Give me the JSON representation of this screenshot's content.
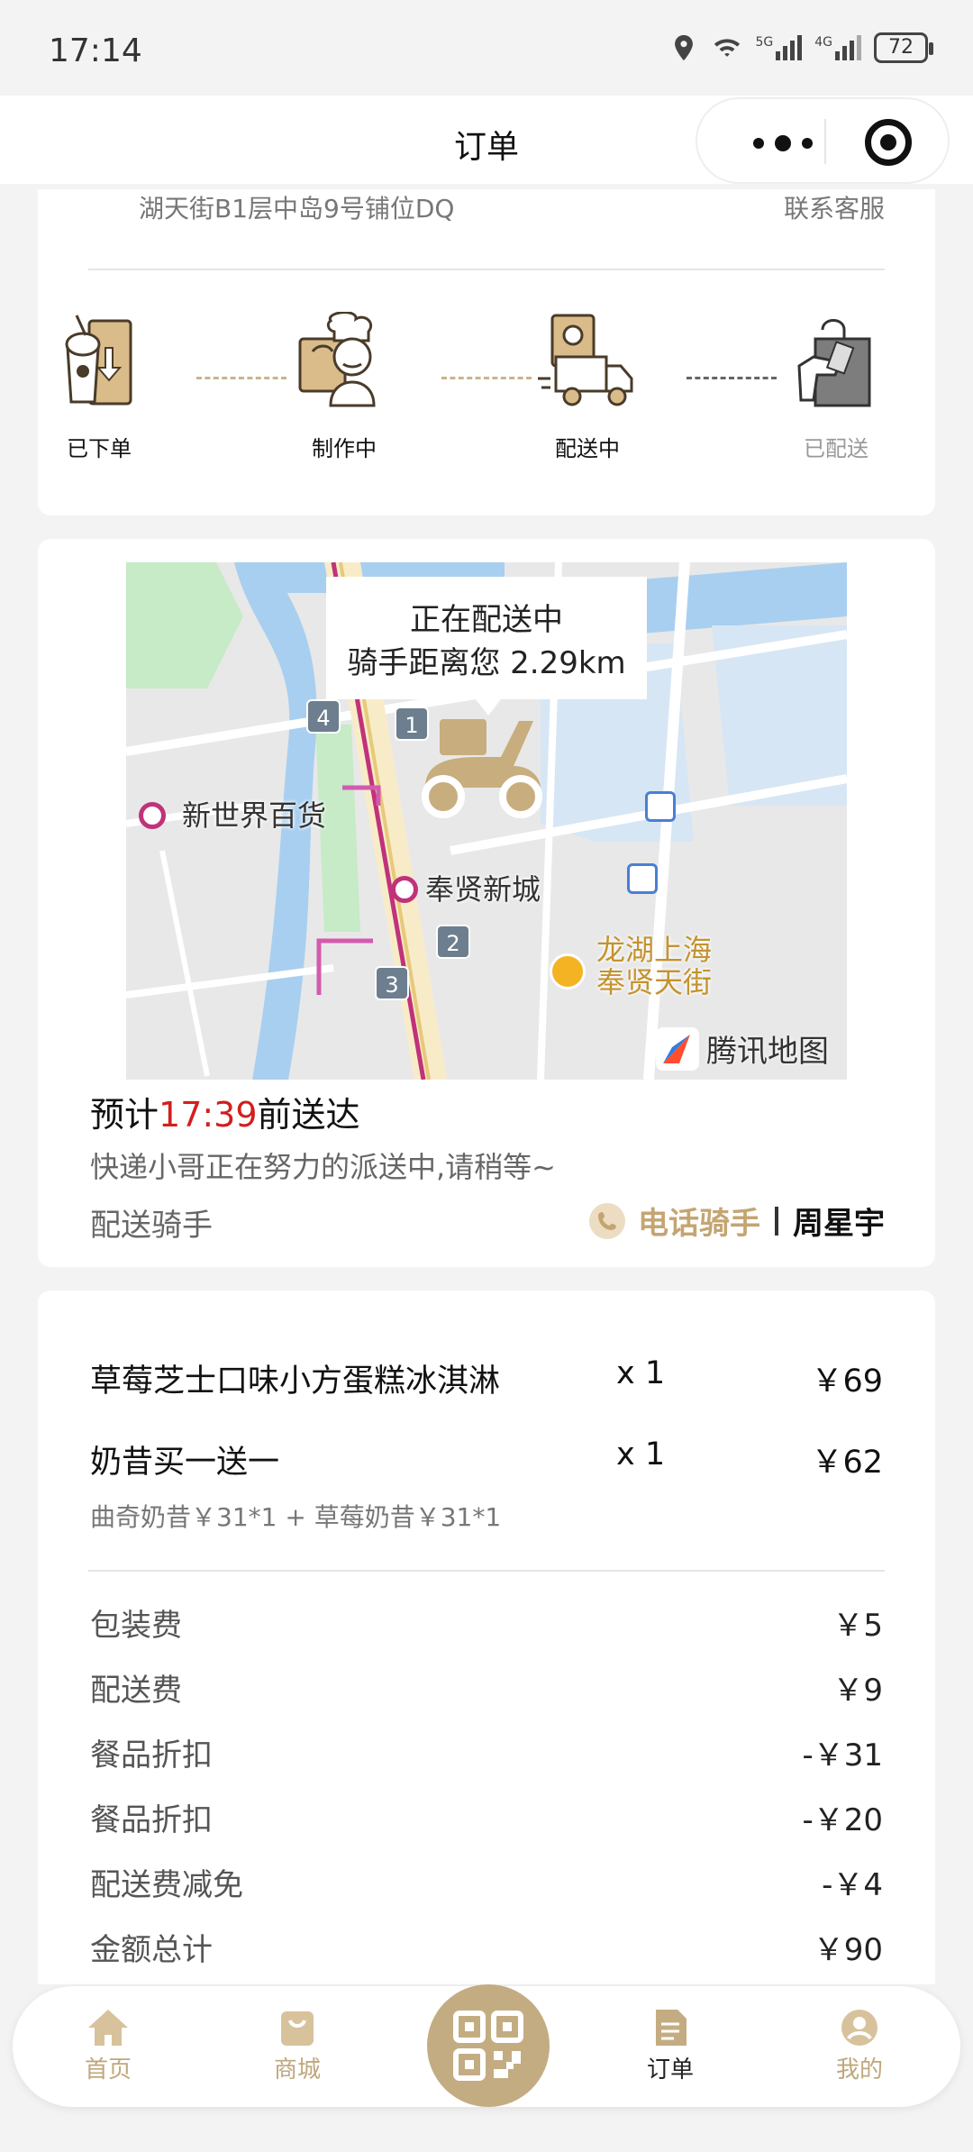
{
  "status_bar": {
    "time": "17:14",
    "battery": "72",
    "network_5g": "5G",
    "network_4g": "4G"
  },
  "nav": {
    "title": "订单"
  },
  "order_progress": {
    "address_fragment": "湖天街B1层中岛9号铺位DQ",
    "contact_service": "联系客服",
    "steps": [
      {
        "label": "已下单",
        "icon": "milkshake-order-icon",
        "state": "done"
      },
      {
        "label": "制作中",
        "icon": "chef-icon",
        "state": "done"
      },
      {
        "label": "配送中",
        "icon": "delivery-truck-icon",
        "state": "current"
      },
      {
        "label": "已配送",
        "icon": "shopping-bag-icon",
        "state": "pending"
      }
    ]
  },
  "map": {
    "bubble_line1": "正在配送中",
    "bubble_line2": "骑手距离您 2.29km",
    "labels": {
      "mall": "新世界百货",
      "metro_station": "奉贤新城",
      "poi_line1": "龙湖上海",
      "poi_line2": "奉贤天街",
      "provider": "腾讯地图"
    },
    "exits": [
      "4",
      "1",
      "2",
      "3"
    ]
  },
  "delivery": {
    "eta_prefix": "预计",
    "eta_time": "17:39",
    "eta_suffix": "前送达",
    "message": "快递小哥正在努力的派送中,请稍等~",
    "rider_label": "配送骑手",
    "call_rider": "电话骑手",
    "rider_name": "周星宇"
  },
  "items": [
    {
      "name": "草莓芝士口味小方蛋糕冰淇淋",
      "qty": "x 1",
      "price": "￥69"
    },
    {
      "name": "奶昔买一送一",
      "qty": "x 1",
      "price": "￥62"
    }
  ],
  "item_detail": "曲奇奶昔￥31*1 + 草莓奶昔￥31*1",
  "fees": [
    {
      "label": "包装费",
      "value": "￥5"
    },
    {
      "label": "配送费",
      "value": "￥9"
    },
    {
      "label": "餐品折扣",
      "value": "-￥31"
    },
    {
      "label": "餐品折扣",
      "value": "-￥20"
    },
    {
      "label": "配送费减免",
      "value": "-￥4"
    },
    {
      "label": "金额总计",
      "value": "￥90"
    }
  ],
  "tabbar": {
    "tabs": [
      {
        "label": "首页",
        "icon": "home-icon"
      },
      {
        "label": "商城",
        "icon": "shop-bag-icon"
      },
      {
        "label": "",
        "icon": "qr-code-icon"
      },
      {
        "label": "订单",
        "icon": "order-document-icon"
      },
      {
        "label": "我的",
        "icon": "profile-icon"
      }
    ],
    "active": "订单"
  },
  "colors": {
    "accent_gold": "#c4ac82",
    "eta_red": "#d21e1e",
    "metro_magenta": "#c0327a"
  }
}
